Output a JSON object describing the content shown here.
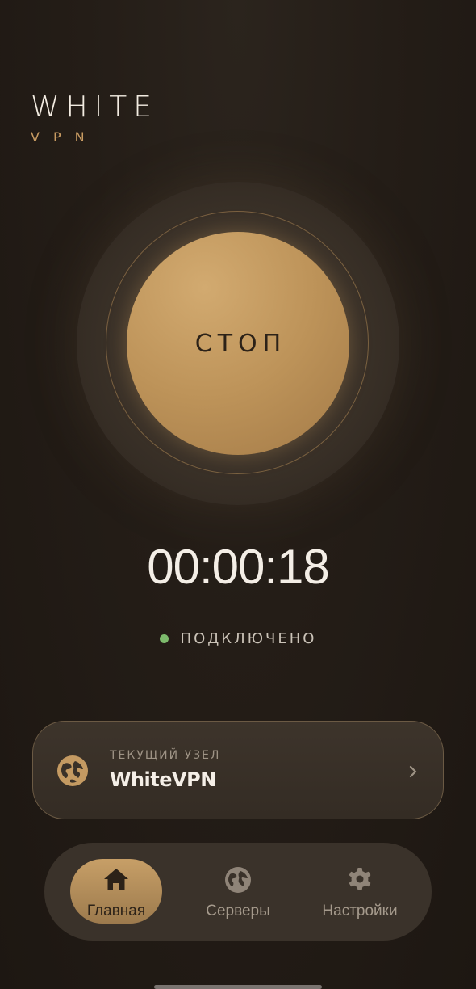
{
  "app": {
    "logo_title": "WHITE",
    "logo_subtitle": "VPN"
  },
  "connect": {
    "button_label": "СТОП",
    "timer": "00:00:18",
    "status": "ПОДКЛЮЧЕНО",
    "status_color": "#7dba6c"
  },
  "node": {
    "caption": "ТЕКУЩИЙ УЗЕЛ",
    "name": "WhiteVPN",
    "icon": "globe-icon"
  },
  "nav": {
    "items": [
      {
        "label": "Главная",
        "icon": "home-icon",
        "active": true
      },
      {
        "label": "Серверы",
        "icon": "globe-icon",
        "active": false
      },
      {
        "label": "Настройки",
        "icon": "gear-icon",
        "active": false
      }
    ]
  },
  "colors": {
    "accent": "#c49a62",
    "background": "#231c16"
  }
}
